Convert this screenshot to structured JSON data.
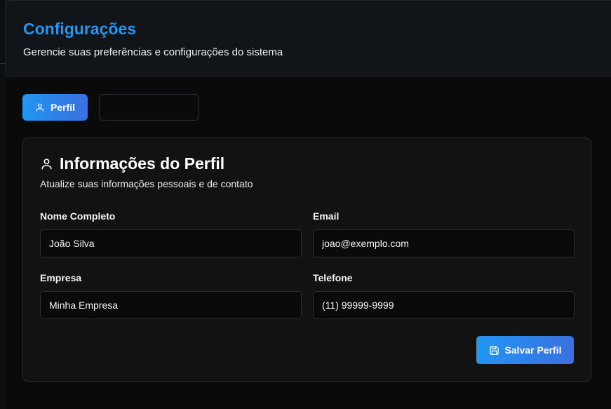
{
  "header": {
    "title": "Configurações",
    "subtitle": "Gerencie suas preferências e configurações do sistema"
  },
  "tabs": [
    {
      "label": "Perfil",
      "icon": "user-icon",
      "active": true
    },
    {
      "label": "",
      "active": false
    }
  ],
  "profile_card": {
    "title": "Informações do Perfil",
    "title_icon": "user-icon",
    "subtitle": "Atualize suas informações pessoais e de contato",
    "fields": {
      "name": {
        "label": "Nome Completo",
        "value": "João Silva"
      },
      "email": {
        "label": "Email",
        "value": "joao@exemplo.com"
      },
      "company": {
        "label": "Empresa",
        "value": "Minha Empresa"
      },
      "phone": {
        "label": "Telefone",
        "value": "(11) 99999-9999"
      }
    },
    "save_button": {
      "label": "Salvar Perfil",
      "icon": "save-icon"
    }
  },
  "colors": {
    "accent": "#2196f3",
    "accent_end": "#3b6fe0",
    "background": "#0a0a0a",
    "card": "#121212",
    "header": "#111418"
  }
}
